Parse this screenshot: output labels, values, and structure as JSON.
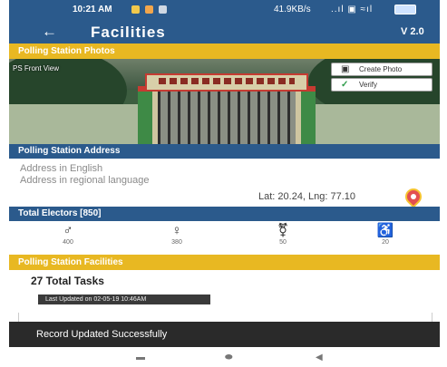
{
  "status_bar": {
    "time": "10:21 AM",
    "network_speed": "41.9KB/s",
    "signal_text": "..ıl ▣ ≈ıl"
  },
  "app_bar": {
    "back_icon": "back-arrow-icon",
    "title": "Facilities",
    "version": "V 2.0"
  },
  "photos_section": {
    "header": "Polling Station Photos",
    "photo_label": "PS Front View",
    "buttons": [
      {
        "label": "Create Photo",
        "icon": "camera-icon"
      },
      {
        "label": "Verify",
        "icon": "check-icon"
      }
    ]
  },
  "address_section": {
    "header": "Polling Station Address",
    "address_english": "Address in English",
    "address_regional": "Address in regional language",
    "lat_lng": "Lat: 20.24, Lng: 77.10",
    "location_icon": "location-pin-icon"
  },
  "electors_section": {
    "header": "Total Electors [850]",
    "items": [
      {
        "icon": "male-icon",
        "label": "400"
      },
      {
        "icon": "female-icon",
        "label": "380"
      },
      {
        "icon": "third-gender-icon",
        "label": "50"
      },
      {
        "icon": "wheelchair-icon",
        "label": "20"
      }
    ]
  },
  "facilities_section": {
    "header": "Polling Station Facilities",
    "total_tasks": "27 Total Tasks",
    "last_updated": "Last Updated on 02-05-19 10:46AM"
  },
  "toast": {
    "message": "Record Updated Successfully"
  },
  "colors": {
    "primary": "#2b5a8c",
    "accent": "#e8b822",
    "toast": "#2a2a2a"
  }
}
